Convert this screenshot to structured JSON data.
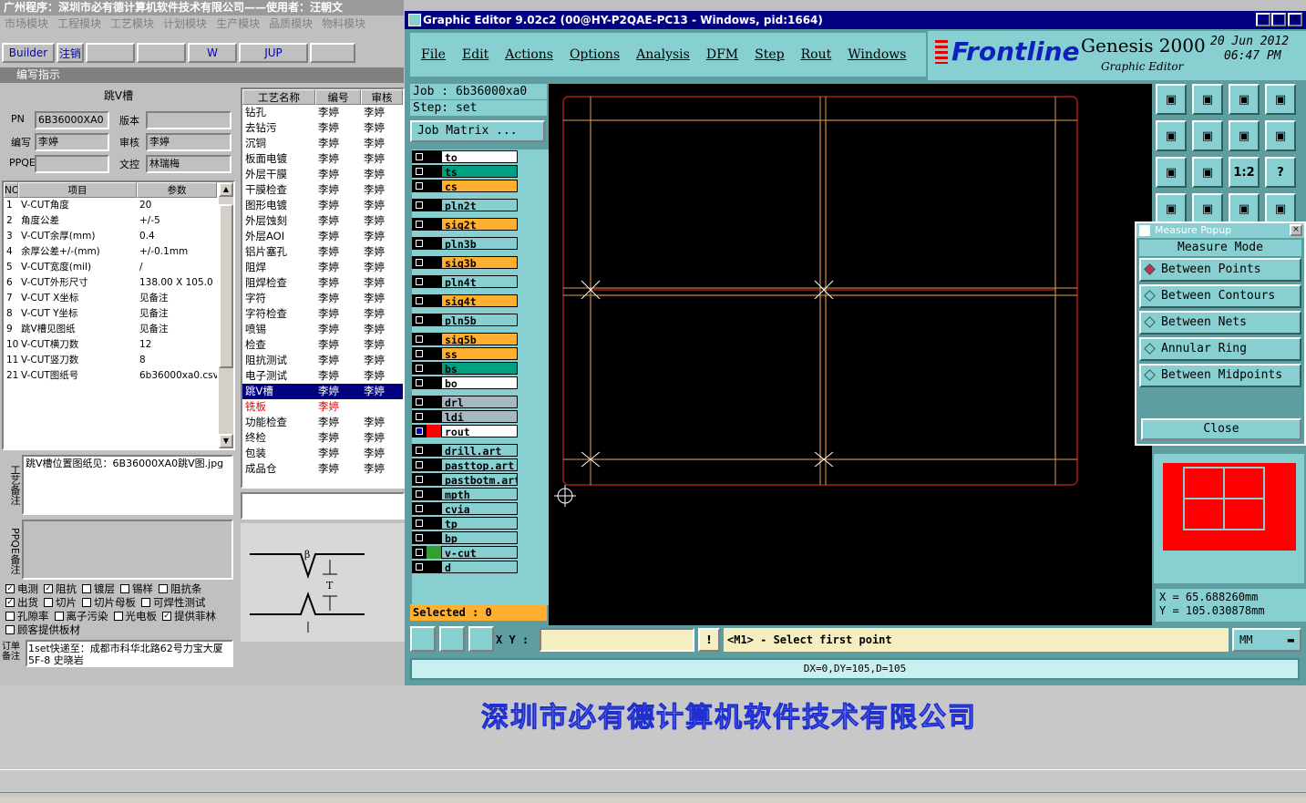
{
  "app": {
    "title": "广州程序：深圳市必有德计算机软件技术有限公司——使用者：汪朝文",
    "menu": [
      "市场模块",
      "工程模块",
      "工艺模块",
      "计划模块",
      "生产模块",
      "品质模块",
      "物料模块"
    ],
    "toolbar": [
      "Builder",
      "注销",
      "",
      "",
      "W",
      "JUP",
      ""
    ]
  },
  "section_title": "编写指示",
  "header_label": "跳V槽",
  "form": {
    "pn_label": "PN",
    "pn_value": "6B36000XA0",
    "ver_label": "版本",
    "ver_value": "",
    "editor_label": "编写",
    "editor_value": "李婷",
    "reviewer_label": "审核",
    "reviewer_value": "李婷",
    "ppqe_label": "PPQE",
    "ppqe_value": "",
    "doc_label": "文控",
    "doc_value": "林瑞梅"
  },
  "params": {
    "headers": [
      "NO",
      "项目",
      "参数"
    ],
    "rows": [
      [
        "1",
        "V-CUT角度",
        "20"
      ],
      [
        "2",
        "角度公差",
        "+/-5"
      ],
      [
        "3",
        "V-CUT余厚(mm)",
        "0.4"
      ],
      [
        "4",
        "余厚公差+/-(mm)",
        "+/-0.1mm"
      ],
      [
        "5",
        "V-CUT宽度(mil)",
        "/"
      ],
      [
        "6",
        "V-CUT外形尺寸",
        "138.00 X 105.0"
      ],
      [
        "7",
        "V-CUT X坐标",
        "见备注"
      ],
      [
        "8",
        "V-CUT Y坐标",
        "见备注"
      ],
      [
        "9",
        "跳V槽见图纸",
        "见备注"
      ],
      [
        "10",
        "V-CUT横刀数",
        "12"
      ],
      [
        "11",
        "V-CUT竖刀数",
        "8"
      ],
      [
        "21",
        "V-CUT图纸号",
        "6b36000xa0.csv"
      ]
    ]
  },
  "process": {
    "headers": [
      "工艺名称",
      "编号",
      "审核"
    ],
    "rows": [
      [
        "钻孔",
        "李婷",
        "李婷"
      ],
      [
        "去钻污",
        "李婷",
        "李婷"
      ],
      [
        "沉铜",
        "李婷",
        "李婷"
      ],
      [
        "板面电镀",
        "李婷",
        "李婷"
      ],
      [
        "外层干膜",
        "李婷",
        "李婷"
      ],
      [
        "干膜检查",
        "李婷",
        "李婷"
      ],
      [
        "图形电镀",
        "李婷",
        "李婷"
      ],
      [
        "外层蚀刻",
        "李婷",
        "李婷"
      ],
      [
        "外层AOI",
        "李婷",
        "李婷"
      ],
      [
        "铝片塞孔",
        "李婷",
        "李婷"
      ],
      [
        "阻焊",
        "李婷",
        "李婷"
      ],
      [
        "阻焊检查",
        "李婷",
        "李婷"
      ],
      [
        "字符",
        "李婷",
        "李婷"
      ],
      [
        "字符检查",
        "李婷",
        "李婷"
      ],
      [
        "喷锡",
        "李婷",
        "李婷"
      ],
      [
        "检查",
        "李婷",
        "李婷"
      ],
      [
        "阻抗测试",
        "李婷",
        "李婷"
      ],
      [
        "电子测试",
        "李婷",
        "李婷"
      ],
      [
        "跳V槽",
        "李婷",
        "李婷"
      ],
      [
        "铣板",
        "李婷",
        ""
      ],
      [
        "功能检查",
        "李婷",
        "李婷"
      ],
      [
        "终检",
        "李婷",
        "李婷"
      ],
      [
        "包装",
        "李婷",
        "李婷"
      ],
      [
        "成品仓",
        "李婷",
        "李婷"
      ]
    ]
  },
  "notes": {
    "process_label": "工艺备注",
    "process_text": "跳V槽位置图纸见：6B36000XA0跳V图.jpg",
    "ppqe_label": "PPQE备注",
    "ppqe_text": ""
  },
  "checkboxes": [
    {
      "label": "电测",
      "checked": true
    },
    {
      "label": "阻抗",
      "checked": true
    },
    {
      "label": "镀层",
      "checked": false
    },
    {
      "label": "锡样",
      "checked": false
    },
    {
      "label": "阻抗条",
      "checked": false
    },
    {
      "label": "出货",
      "checked": true
    },
    {
      "label": "切片",
      "checked": false
    },
    {
      "label": "切片母板",
      "checked": false
    },
    {
      "label": "可焊性测试",
      "checked": false
    },
    {
      "label": "孔隙率",
      "checked": false
    },
    {
      "label": "离子污染",
      "checked": false
    },
    {
      "label": "光电板",
      "checked": false
    },
    {
      "label": "提供菲林",
      "checked": true
    },
    {
      "label": "顾客提供板材",
      "checked": false
    }
  ],
  "order": {
    "label": "订单备注",
    "text": "1set快递至：成都市科华北路62号力宝大厦5F-8  史晓岩"
  },
  "diagram": {
    "beta": "β",
    "t": "T"
  },
  "genesis": {
    "title": "Graphic Editor 9.02c2 (00@HY-P2QAE-PC13 - Windows, pid:1664)",
    "menu": [
      "File",
      "Edit",
      "Actions",
      "Options",
      "Analysis",
      "DFM",
      "Step",
      "Rout",
      "Windows",
      "Help"
    ],
    "brand": "Frontline",
    "product": "Genesis 2000",
    "subtitle": "Graphic Editor",
    "date": "20  Jun  2012",
    "time": "06:47  PM",
    "job": "Job  :  6b36000xa0",
    "step": "Step:  set",
    "job_matrix": "Job Matrix ...",
    "layers": [
      {
        "name": "to",
        "color": "#ffffff"
      },
      {
        "name": "ts",
        "color": "#00a080"
      },
      {
        "name": "cs",
        "color": "#ffb030"
      },
      {
        "name": "pln2t",
        "color": "#87cfd0"
      },
      {
        "name": "sig2t",
        "color": "#ffb030"
      },
      {
        "name": "pln3b",
        "color": "#87cfd0"
      },
      {
        "name": "sig3b",
        "color": "#ffb030"
      },
      {
        "name": "pln4t",
        "color": "#87cfd0"
      },
      {
        "name": "sig4t",
        "color": "#ffb030"
      },
      {
        "name": "pln5b",
        "color": "#87cfd0"
      },
      {
        "name": "sig5b",
        "color": "#ffb030"
      },
      {
        "name": "ss",
        "color": "#ffb030"
      },
      {
        "name": "bs",
        "color": "#00a080"
      },
      {
        "name": "bo",
        "color": "#ffffff"
      },
      {
        "name": "drl",
        "color": "#a8b8c0"
      },
      {
        "name": "ldi",
        "color": "#a8b8c0"
      },
      {
        "name": "rout",
        "color": "#ffffff"
      },
      {
        "name": "drill.art",
        "color": "#87cfd0"
      },
      {
        "name": "pasttop.art",
        "color": "#87cfd0"
      },
      {
        "name": "pastbotm.art",
        "color": "#87cfd0"
      },
      {
        "name": "mpth",
        "color": "#87cfd0"
      },
      {
        "name": "cvia",
        "color": "#87cfd0"
      },
      {
        "name": "tp",
        "color": "#87cfd0"
      },
      {
        "name": "bp",
        "color": "#87cfd0"
      },
      {
        "name": "v-cut",
        "color": "#87cfd0"
      },
      {
        "name": "d",
        "color": "#87cfd0"
      }
    ],
    "selected": "Selected : 0",
    "xy_label": "X Y :",
    "prompt": "<M1> - Select first point",
    "units": "MM",
    "status": "DX=0,DY=105,D=105",
    "coord_x": "X  =  65.688260mm",
    "coord_y": "Y  =  105.030878mm",
    "tools": [
      "1:2",
      "?"
    ]
  },
  "measure": {
    "title": "Measure Popup",
    "mode_label": "Measure Mode",
    "options": [
      "Between Points",
      "Between Contours",
      "Between Nets",
      "Annular Ring",
      "Between Midpoints"
    ],
    "close": "Close"
  },
  "footer": {
    "company": "深圳市必有德计算机软件技术有限公司"
  }
}
